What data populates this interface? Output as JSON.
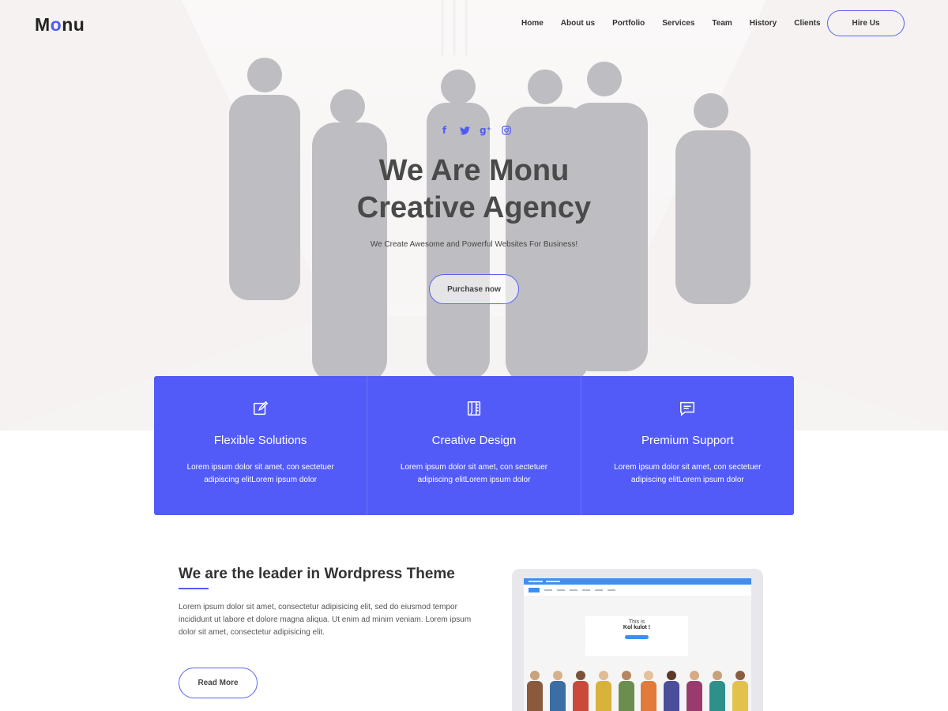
{
  "brand": {
    "logo_prefix": "M",
    "logo_o": "o",
    "logo_suffix": "nu",
    "accent": "#525bf8"
  },
  "nav": {
    "items": [
      "Home",
      "About us",
      "Portfolio",
      "Services",
      "Team",
      "History",
      "Clients"
    ],
    "hire_label": "Hire Us"
  },
  "social": [
    "facebook-icon",
    "twitter-icon",
    "google-plus-icon",
    "instagram-icon"
  ],
  "hero": {
    "title_line1": "We Are Monu",
    "title_line2": "Creative Agency",
    "subtitle": "We Create Awesome and Powerful Websites For Business!",
    "cta_label": "Purchase now"
  },
  "features": [
    {
      "icon": "edit-icon",
      "title": "Flexible Solutions",
      "line1": "Lorem ipsum dolor sit amet, con sectetuer",
      "line2": "adipiscing elitLorem ipsum dolor"
    },
    {
      "icon": "pencil-ruler-icon",
      "title": "Creative Design",
      "line1": "Lorem ipsum dolor sit amet, con sectetuer",
      "line2": "adipiscing elitLorem ipsum dolor"
    },
    {
      "icon": "chat-icon",
      "title": "Premium Support",
      "line1": "Lorem ipsum dolor sit amet, con sectetuer",
      "line2": "adipiscing elitLorem ipsum dolor"
    }
  ],
  "about": {
    "title": "We are the leader in Wordpress Theme",
    "text": "Lorem ipsum dolor sit amet, consectetur adipisicing elit, sed do eiusmod tempor incididunt ut labore et dolore magna aliqua. Ut enim ad minim veniam. Lorem ipsum dolor sit amet, consectetur adipisicing elit.",
    "cta_label": "Read More"
  },
  "mockup": {
    "card_line1": "This is",
    "card_line2": "Kol kulot !"
  }
}
